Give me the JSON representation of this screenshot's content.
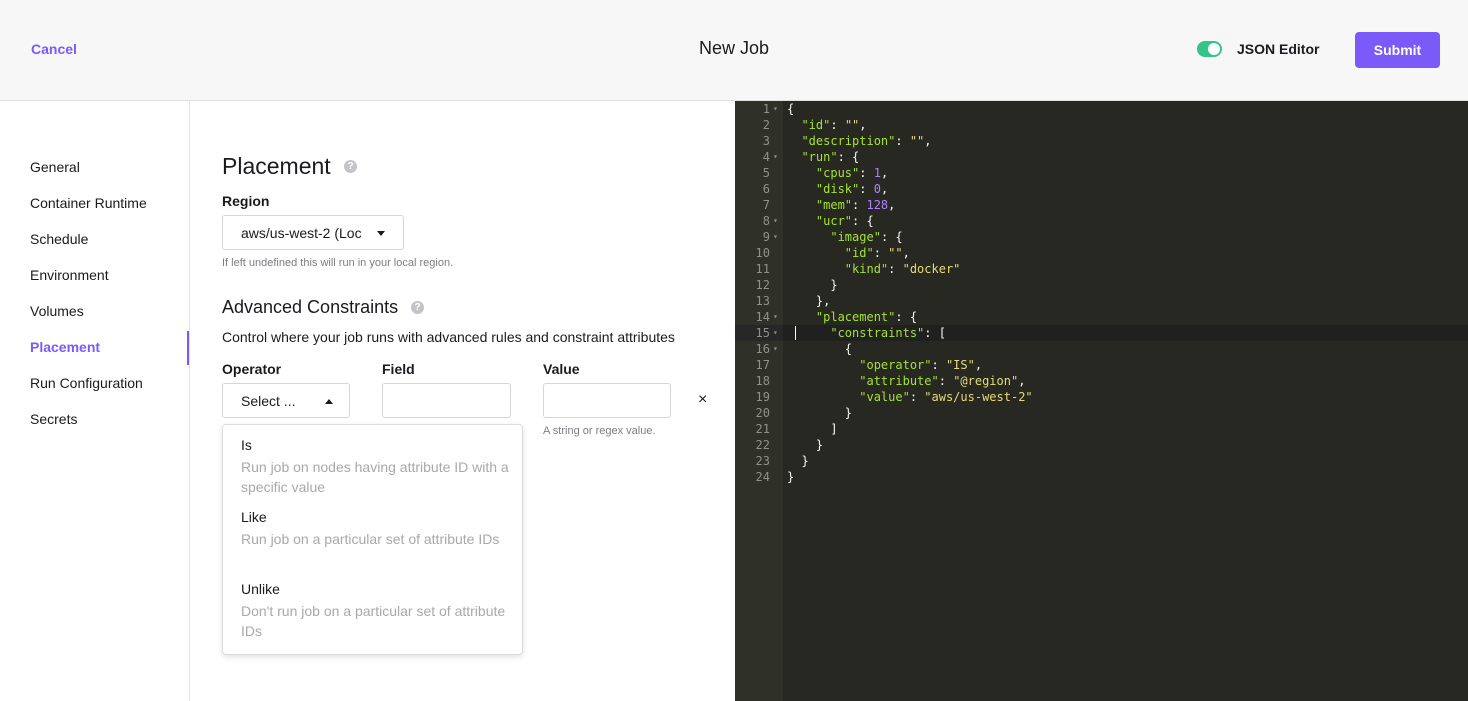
{
  "header": {
    "cancel_label": "Cancel",
    "title": "New Job",
    "json_editor_label": "JSON Editor",
    "json_editor_enabled": true,
    "submit_label": "Submit",
    "accent_color": "#7a5af8",
    "toggle_color": "#35c48a"
  },
  "sidebar": {
    "items": [
      {
        "label": "General"
      },
      {
        "label": "Container Runtime"
      },
      {
        "label": "Schedule"
      },
      {
        "label": "Environment"
      },
      {
        "label": "Volumes"
      },
      {
        "label": "Placement",
        "active": true
      },
      {
        "label": "Run Configuration"
      },
      {
        "label": "Secrets"
      }
    ]
  },
  "placement": {
    "title": "Placement",
    "region_label": "Region",
    "region_value": "aws/us-west-2 (Loc",
    "region_hint": "If left undefined this will run in your local region.",
    "advanced_title": "Advanced Constraints",
    "advanced_desc": "Control where your job runs with advanced rules and constraint attributes",
    "operator_label": "Operator",
    "operator_value": "Select ...",
    "field_label": "Field",
    "value_label": "Value",
    "value_hint": "A string or regex value.",
    "close_glyph": "×",
    "operator_options": [
      {
        "label": "Is",
        "description": "Run job on nodes having attribute ID with a specific value"
      },
      {
        "label": "Like",
        "description": "Run job on a particular set of attribute IDs"
      },
      {
        "label": "Unlike",
        "description": "Don't run job on a particular set of attribute IDs"
      }
    ]
  },
  "editor": {
    "lines": [
      "{",
      "  \"id\": \"\",",
      "  \"description\": \"\",",
      "  \"run\": {",
      "    \"cpus\": 1,",
      "    \"disk\": 0,",
      "    \"mem\": 128,",
      "    \"ucr\": {",
      "      \"image\": {",
      "        \"id\": \"\",",
      "        \"kind\": \"docker\"",
      "      }",
      "    },",
      "    \"placement\": {",
      "      \"constraints\": [",
      "        {",
      "          \"operator\": \"IS\",",
      "          \"attribute\": \"@region\",",
      "          \"value\": \"aws/us-west-2\"",
      "        }",
      "      ]",
      "    }",
      "  }",
      "}"
    ],
    "fold_lines": [
      1,
      4,
      8,
      9,
      14,
      15,
      16
    ],
    "active_line": 15,
    "colors": {
      "background": "#272822",
      "key": "#a6e22e",
      "string": "#e6db74",
      "number": "#ae81ff"
    }
  }
}
